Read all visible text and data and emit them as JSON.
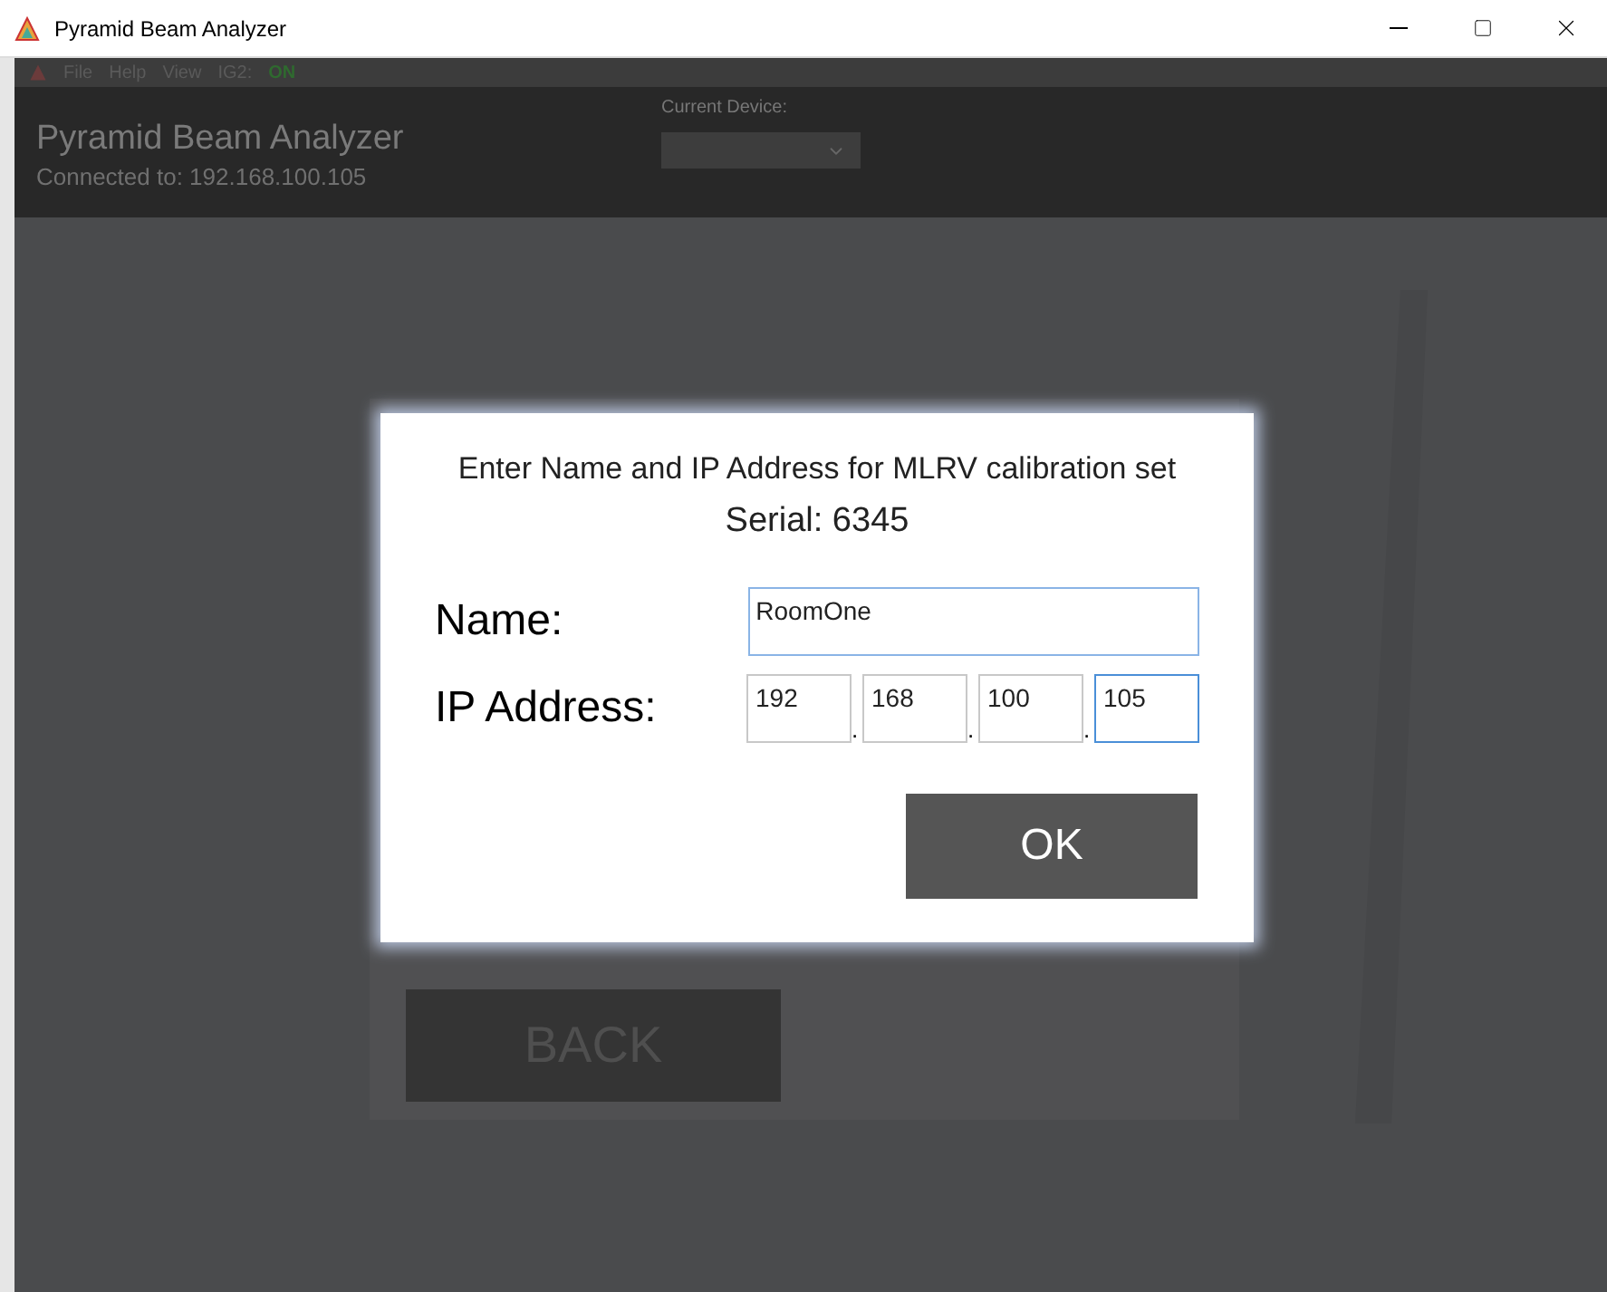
{
  "window": {
    "title": "Pyramid Beam Analyzer"
  },
  "menu": [
    {
      "label": "File",
      "kind": "item"
    },
    {
      "label": "Help",
      "kind": "item"
    },
    {
      "label": "View",
      "kind": "item"
    },
    {
      "label": "IG2:",
      "kind": "item"
    },
    {
      "label": "ON",
      "kind": "status"
    }
  ],
  "header": {
    "title": "Pyramid Beam Analyzer",
    "subtitle": "Connected to: 192.168.100.105",
    "device_label": "Current Device:"
  },
  "back_button": "BACK",
  "dialog": {
    "heading": "Enter Name and IP Address for MLRV calibration set",
    "serial": "Serial: 6345",
    "name_label": "Name:",
    "name_value": "RoomOne",
    "ip_label": "IP Address:",
    "ip_octets": [
      {
        "value": "192",
        "focused": false
      },
      {
        "value": "168",
        "focused": false
      },
      {
        "value": "100",
        "focused": false
      },
      {
        "value": "105",
        "focused": true
      }
    ],
    "separator": ".",
    "ok_button": "OK"
  }
}
